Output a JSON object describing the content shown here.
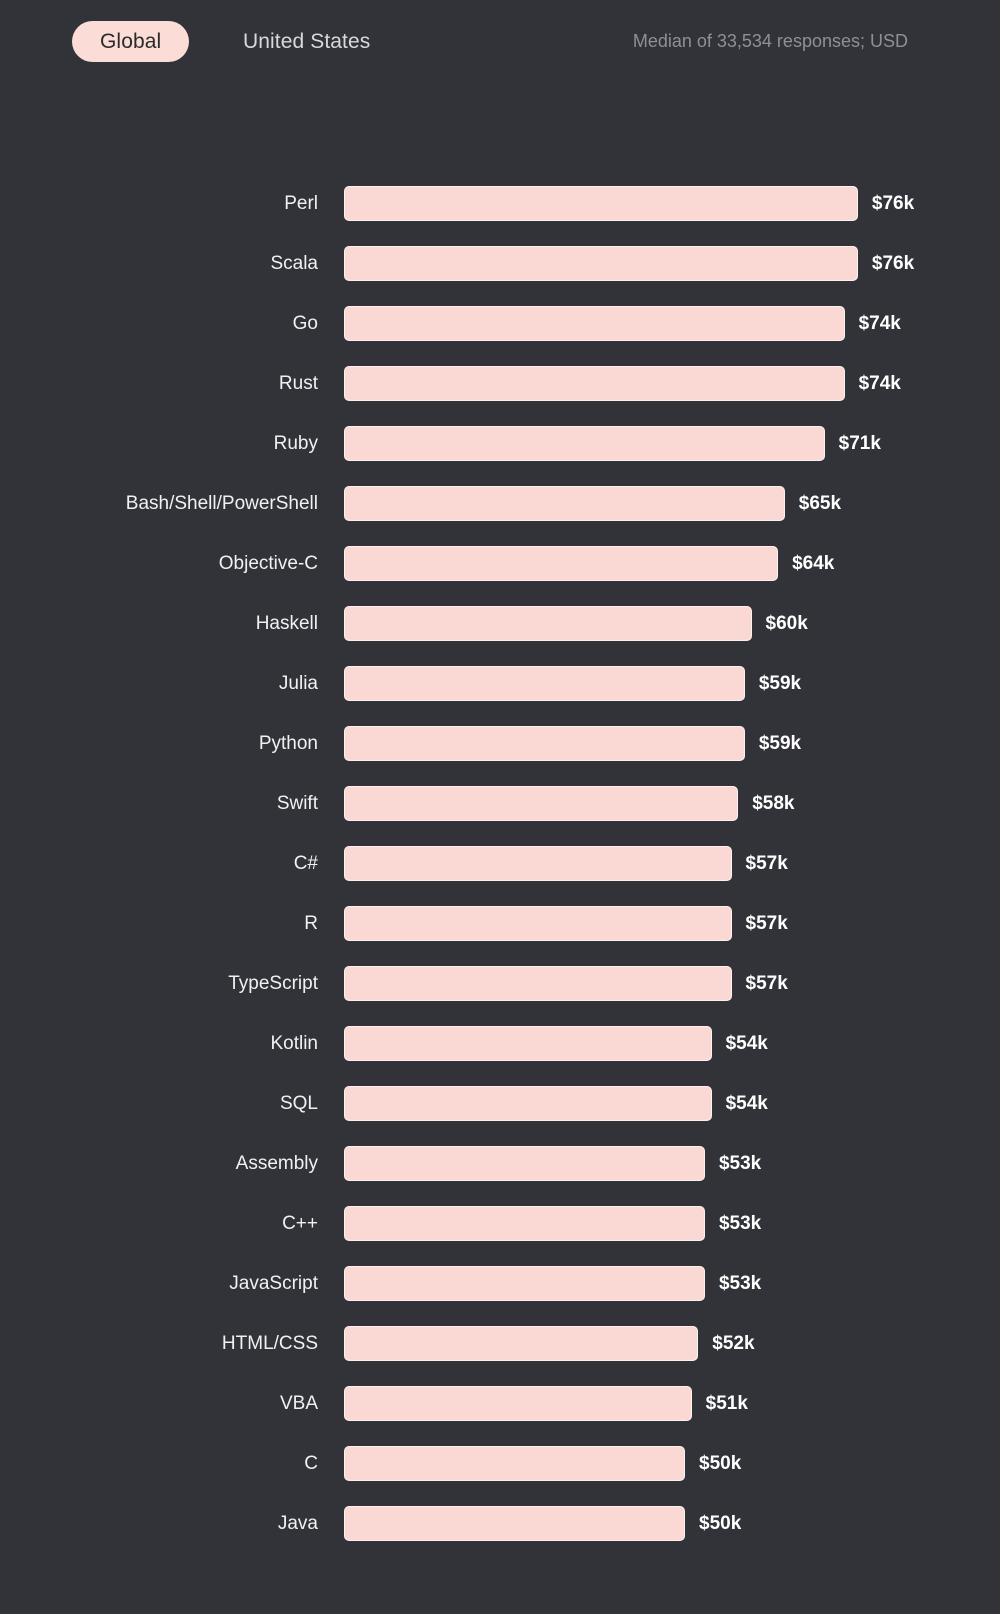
{
  "header": {
    "tabs": [
      {
        "label": "Global",
        "selected": true
      },
      {
        "label": "United States",
        "selected": false
      }
    ],
    "caption": "Median of 33,534 responses; USD"
  },
  "colors": {
    "background": "#313339",
    "bar_fill": "#fad9d5",
    "bar_border": "#fff0ee",
    "pill_background": "#fbdcd7",
    "pill_text": "#2b2b2b",
    "label_text": "#f0f1f3",
    "value_text": "#ffffff",
    "caption_text": "#8d9098"
  },
  "chart_data": {
    "type": "bar",
    "orientation": "horizontal",
    "title": "",
    "subtitle": "",
    "xlabel": "",
    "ylabel": "",
    "grid": false,
    "legend": "none",
    "value_prefix": "$",
    "value_suffix": "k",
    "units": "USD thousands (median)",
    "xlim": [
      0,
      80
    ],
    "categories": [
      "Perl",
      "Scala",
      "Go",
      "Rust",
      "Ruby",
      "Bash/Shell/PowerShell",
      "Objective-C",
      "Haskell",
      "Julia",
      "Python",
      "Swift",
      "C#",
      "R",
      "TypeScript",
      "Kotlin",
      "SQL",
      "Assembly",
      "C++",
      "JavaScript",
      "HTML/CSS",
      "VBA",
      "C",
      "Java"
    ],
    "values": [
      76,
      76,
      74,
      74,
      71,
      65,
      64,
      60,
      59,
      59,
      58,
      57,
      57,
      57,
      54,
      54,
      53,
      53,
      53,
      52,
      51,
      50,
      50
    ],
    "labels": [
      "$76k",
      "$76k",
      "$74k",
      "$74k",
      "$71k",
      "$65k",
      "$64k",
      "$60k",
      "$59k",
      "$59k",
      "$58k",
      "$57k",
      "$57k",
      "$57k",
      "$54k",
      "$54k",
      "$53k",
      "$53k",
      "$53k",
      "$52k",
      "$51k",
      "$50k",
      "$50k"
    ]
  }
}
